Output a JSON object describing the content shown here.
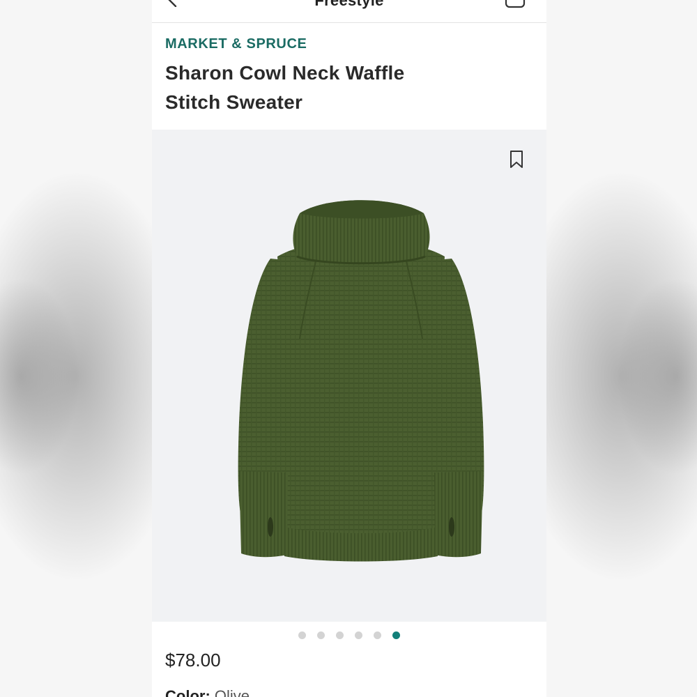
{
  "nav": {
    "title": "Freestyle",
    "back_icon": "chevron-left-icon",
    "cart_icon": "bag-icon"
  },
  "product": {
    "brand": "MARKET & SPRUCE",
    "title": "Sharon Cowl Neck Waffle Stitch Sweater",
    "price": "$78.00",
    "color_label": "Color:",
    "color_value": "Olive",
    "image": "olive-green-cowl-neck-sweater",
    "bookmark_icon": "bookmark-icon"
  },
  "carousel": {
    "total": 6,
    "active_index": 5
  },
  "colors": {
    "brand_teal": "#1a6b63",
    "dot_active": "#12807a",
    "dot_inactive": "#d3d3d3",
    "image_bg": "#f1f2f4",
    "sweater": "#4a5e2f"
  }
}
